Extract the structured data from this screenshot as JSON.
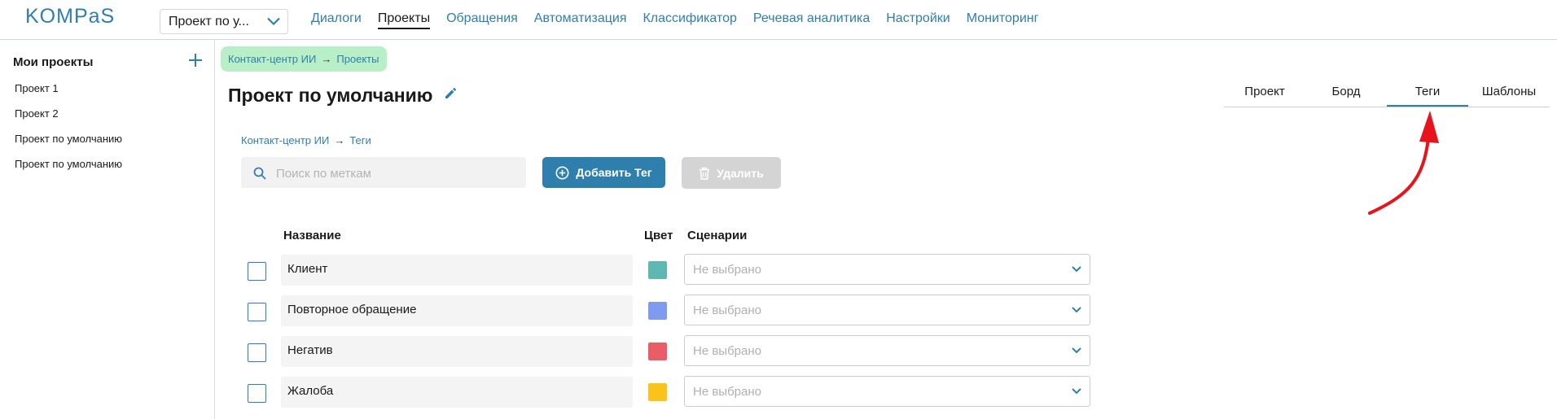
{
  "header": {
    "logo": "KOMPaS",
    "project_select": "Проект по у...",
    "nav": [
      "Диалоги",
      "Проекты",
      "Обращения",
      "Автоматизация",
      "Классификатор",
      "Речевая аналитика",
      "Настройки",
      "Мониторинг"
    ],
    "nav_active": "Проекты"
  },
  "sidebar": {
    "title": "Мои проекты",
    "items": [
      "Проект 1",
      "Проект 2",
      "Проект по умолчанию",
      "Проект по умолчанию"
    ]
  },
  "breadcrumb_top": {
    "parent": "Контакт-центр ИИ",
    "arrow": "→",
    "current": "Проекты"
  },
  "page": {
    "title": "Проект по умолчанию"
  },
  "tabs": {
    "items": [
      "Проект",
      "Борд",
      "Теги",
      "Шаблоны"
    ],
    "active": "Теги"
  },
  "breadcrumb_tags": {
    "parent": "Контакт-центр ИИ",
    "arrow": "→",
    "current": "Теги"
  },
  "toolbar": {
    "search_placeholder": "Поиск по меткам",
    "add_label": "Добавить Тег",
    "delete_label": "Удалить"
  },
  "table": {
    "headers": {
      "name": "Название",
      "color": "Цвет",
      "scenarios": "Сценарии"
    },
    "rows": [
      {
        "name": "Клиент",
        "color": "#5cb8b0",
        "scenario": "Не выбрано"
      },
      {
        "name": "Повторное обращение",
        "color": "#7f9bef",
        "scenario": "Не выбрано"
      },
      {
        "name": "Негатив",
        "color": "#ea5d67",
        "scenario": "Не выбрано"
      },
      {
        "name": "Жалоба",
        "color": "#fbc21a",
        "scenario": "Не выбрано"
      }
    ]
  },
  "colors": {
    "accent": "#2f7fae",
    "breadcrumb_bg": "#b9efc7",
    "annotation_arrow": "#e8141c"
  }
}
